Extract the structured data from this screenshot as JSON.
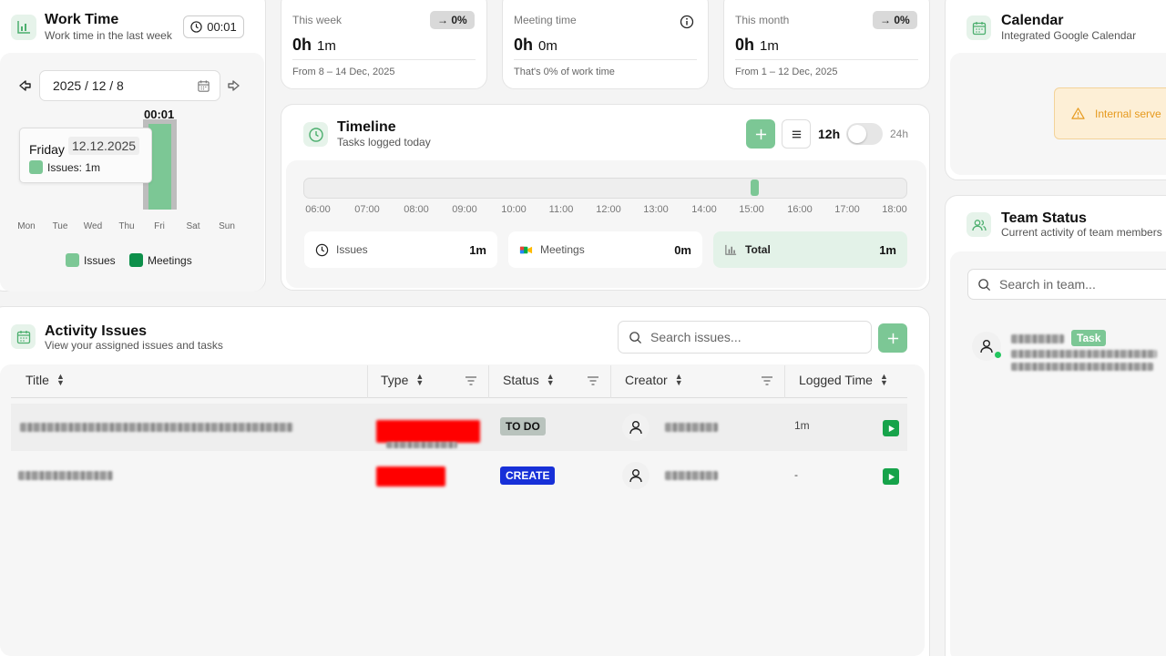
{
  "work_time": {
    "title": "Work Time",
    "subtitle": "Work time in the last week",
    "badge": "00:01",
    "date": "2025 / 12 / 8",
    "bar_label": "00:01",
    "tooltip": {
      "day": "Friday",
      "date": "12.12.2025",
      "series": "Issues: 1m"
    },
    "days": [
      "Mon",
      "Tue",
      "Wed",
      "Thu",
      "Fri",
      "Sat",
      "Sun"
    ],
    "legend": [
      "Issues",
      "Meetings"
    ],
    "colors": {
      "issues": "#7cc795",
      "meetings": "#0d8f4a"
    }
  },
  "stats": [
    {
      "label": "This week",
      "hours": "0h",
      "minutes": "1m",
      "badge": "→ 0%",
      "footer": "From 8 – 14 Dec, 2025"
    },
    {
      "label": "Meeting time",
      "hours": "0h",
      "minutes": "0m",
      "footer": "That's 0% of work time"
    },
    {
      "label": "This month",
      "hours": "0h",
      "minutes": "1m",
      "badge": "→ 0%",
      "footer": "From 1 – 12 Dec, 2025"
    }
  ],
  "timeline": {
    "title": "Timeline",
    "subtitle": "Tasks logged today",
    "mode_12": "12h",
    "mode_24": "24h",
    "ticks": [
      "06:00",
      "07:00",
      "08:00",
      "09:00",
      "10:00",
      "11:00",
      "12:00",
      "13:00",
      "14:00",
      "15:00",
      "16:00",
      "17:00",
      "18:00"
    ],
    "summary": [
      {
        "label": "Issues",
        "value": "1m"
      },
      {
        "label": "Meetings",
        "value": "0m"
      },
      {
        "label": "Total",
        "value": "1m"
      }
    ]
  },
  "calendar": {
    "title": "Calendar",
    "subtitle": "Integrated Google Calendar",
    "alert": "Internal serve"
  },
  "team": {
    "title": "Team Status",
    "subtitle": "Current activity of team members",
    "search_placeholder": "Search in team...",
    "member_badge": "Task"
  },
  "issues": {
    "title": "Activity Issues",
    "subtitle": "View your assigned issues and tasks",
    "search_placeholder": "Search issues...",
    "columns": [
      "Title",
      "Type",
      "Status",
      "Creator",
      "Logged Time"
    ],
    "rows": [
      {
        "status": "TO DO",
        "logged": "1m"
      },
      {
        "status": "CREATE",
        "logged": "-"
      }
    ]
  }
}
